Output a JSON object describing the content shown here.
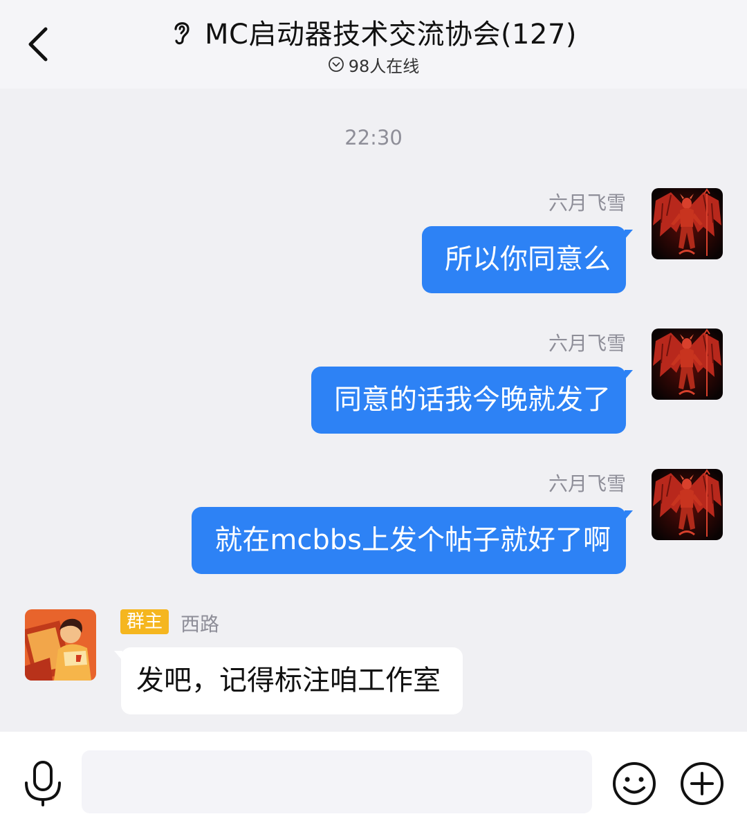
{
  "header": {
    "title": "MC启动器技术交流协会(127)",
    "online_status": "98人在线",
    "back_icon": "chevron-left-icon",
    "ear_icon": "ear-icon"
  },
  "timestamp": "22:30",
  "messages": [
    {
      "sender": "六月飞雪",
      "text": "所以你同意么",
      "direction": "outgoing"
    },
    {
      "sender": "六月飞雪",
      "text": "同意的话我今晚就发了",
      "direction": "outgoing"
    },
    {
      "sender": "六月飞雪",
      "text": "就在mcbbs上发个帖子就好了啊",
      "direction": "outgoing"
    },
    {
      "sender": "西路",
      "badge": "群主",
      "text": "发吧，记得标注咱工作室",
      "direction": "incoming"
    }
  ],
  "input_bar": {
    "text_value": "",
    "mic_icon": "microphone-icon",
    "emoji_icon": "smiley-icon",
    "plus_icon": "plus-circle-icon"
  },
  "colors": {
    "outgoing_bubble": "#2d82f5",
    "incoming_bubble": "#ffffff",
    "badge_owner": "#f5b61f",
    "chat_background": "#f0f0f3"
  }
}
